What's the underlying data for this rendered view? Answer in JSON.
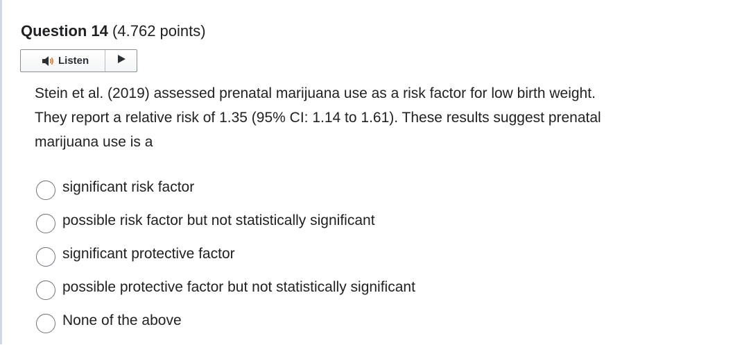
{
  "question": {
    "title": "Question 14",
    "points": "(4.762 points)"
  },
  "listen": {
    "label": "Listen",
    "speaker_icon": "speaker-icon",
    "play_icon": "play-icon"
  },
  "prompt": "Stein et al. (2019) assessed prenatal marijuana use as a risk factor for low birth weight. They report a relative risk of 1.35 (95% CI: 1.14 to 1.61). These results suggest prenatal marijuana use is a",
  "options": [
    {
      "label": "significant risk factor",
      "selected": false
    },
    {
      "label": "possible risk factor but not statistically significant",
      "selected": false
    },
    {
      "label": "significant protective factor",
      "selected": false
    },
    {
      "label": "possible protective factor but not statistically significant",
      "selected": false
    },
    {
      "label": "None of the above",
      "selected": false
    }
  ],
  "colors": {
    "text": "#202122",
    "border": "#6e7379",
    "play_arrow": "#2b2e33"
  }
}
